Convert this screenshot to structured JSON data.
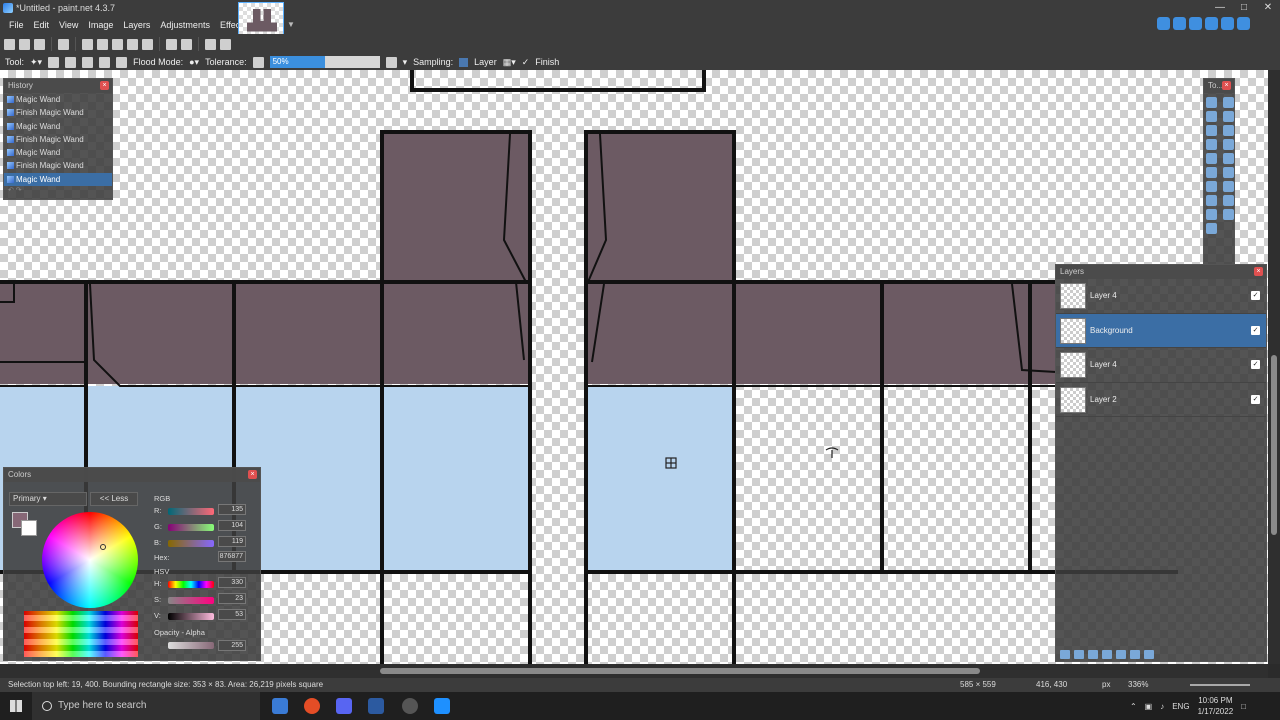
{
  "app": {
    "title": "*Untitled - paint.net 4.3.7"
  },
  "menu": [
    "File",
    "Edit",
    "View",
    "Image",
    "Layers",
    "Adjustments",
    "Effects"
  ],
  "toolbar2": {
    "tool_label": "Tool:",
    "flood_mode_label": "Flood Mode:",
    "tolerance_label": "Tolerance:",
    "tolerance_value": "50%",
    "tolerance_fraction": 0.5,
    "sampling_label": "Sampling:",
    "sampling_value": "Layer",
    "finish_label": "Finish"
  },
  "history": {
    "title": "History",
    "items": [
      "Magic Wand",
      "Finish Magic Wand",
      "Magic Wand",
      "Finish Magic Wand",
      "Magic Wand",
      "Finish Magic Wand",
      "Magic Wand"
    ],
    "selected_index": 6
  },
  "tools_panel": {
    "title": "To..."
  },
  "layers": {
    "title": "Layers",
    "items": [
      {
        "name": "Layer 4",
        "visible": true,
        "selected": false
      },
      {
        "name": "Background",
        "visible": true,
        "selected": true
      },
      {
        "name": "Layer 4",
        "visible": true,
        "selected": false
      },
      {
        "name": "Layer 2",
        "visible": true,
        "selected": false
      }
    ]
  },
  "colors": {
    "title": "Colors",
    "mode": "Primary",
    "less_button": "<< Less",
    "rgb_label": "RGB",
    "r_label": "R:",
    "r_value": "135",
    "g_label": "G:",
    "g_value": "104",
    "b_label": "B:",
    "b_value": "119",
    "hex_label": "Hex:",
    "hex_value": "876877",
    "hsv_label": "HSV",
    "h_label": "H:",
    "h_value": "330",
    "s_label": "S:",
    "s_value": "23",
    "v_label": "V:",
    "v_value": "53",
    "opacity_label": "Opacity - Alpha",
    "opacity_value": "255",
    "primary_color": "#876877",
    "secondary_color": "#ffffff"
  },
  "status": {
    "selection_text": "Selection top left: 19, 400. Bounding rectangle size: 353 × 83. Area: 26,219 pixels square",
    "image_size": "585 × 559",
    "cursor_pos": "416, 430",
    "unit": "px",
    "zoom": "336%"
  },
  "taskbar": {
    "search_placeholder": "Type here to search",
    "language": "ENG",
    "time": "10:06 PM",
    "date": "1/17/2022"
  },
  "colors_theme": {
    "selection_blue": "#b8d4ee",
    "tile_fill": "#6c5a63",
    "accent": "#3b8fde"
  }
}
